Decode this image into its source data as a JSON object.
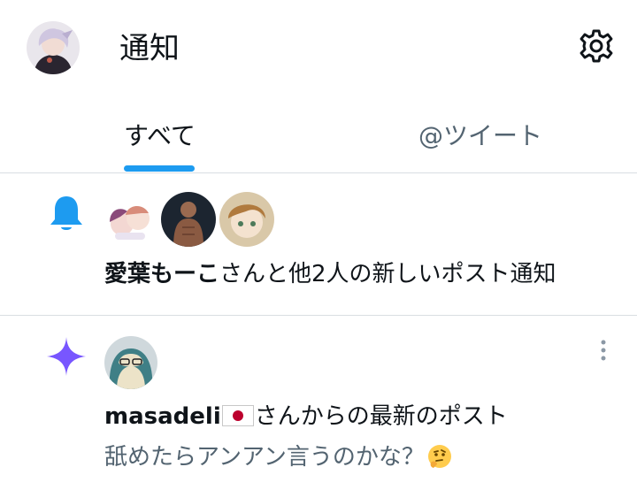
{
  "header": {
    "title": "通知",
    "avatar_icon": "user-avatar",
    "settings_icon": "gear-icon"
  },
  "tabs": [
    {
      "label": "すべて",
      "active": true
    },
    {
      "label": "@ツイート",
      "active": false
    }
  ],
  "notifications": [
    {
      "icon": "bell-icon",
      "icon_color": "#1d9bf0",
      "avatars": [
        "user-avatar-1",
        "user-avatar-2",
        "user-avatar-3"
      ],
      "name": "愛葉もーこ",
      "text": "さんと他2人の新しいポスト通知"
    },
    {
      "icon": "sparkle-icon",
      "icon_color": "#7856ff",
      "avatar": "user-avatar-snorlax",
      "name": "masadeli",
      "flag": "japan-flag",
      "text": "さんからの最新のポスト",
      "post": "舐めたらアンアン言うのかな？",
      "post_emoji": "thinking-face-emoji",
      "more_icon": "more-vertical-icon"
    }
  ],
  "colors": {
    "accent": "#1d9bf0",
    "secondary_text": "#536471",
    "divider": "#d9dee2"
  }
}
